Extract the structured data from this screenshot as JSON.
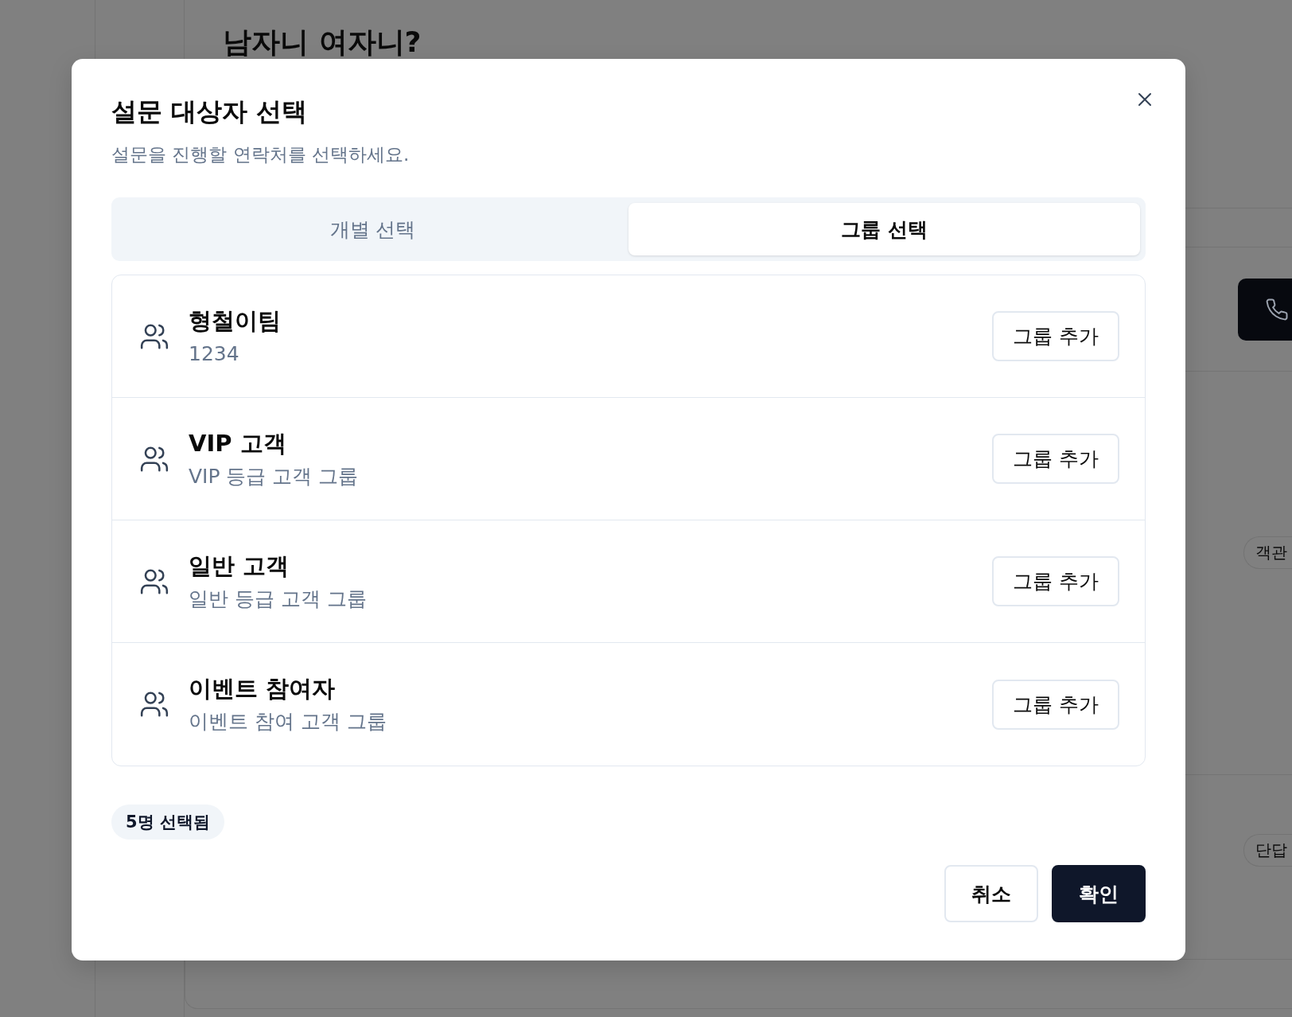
{
  "background": {
    "heading": "남자니 여자니?",
    "chips": [
      {
        "label": "객관"
      },
      {
        "label": "단답"
      }
    ]
  },
  "dialog": {
    "title": "설문 대상자 선택",
    "description": "설문을 진행할 연락처를 선택하세요.",
    "tabs": [
      {
        "label": "개별 선택",
        "selected": false
      },
      {
        "label": "그룹 선택",
        "selected": true
      }
    ],
    "groups": [
      {
        "name": "형철이팀",
        "description": "1234",
        "button": "그룹 추가"
      },
      {
        "name": "VIP 고객",
        "description": "VIP 등급 고객 그룹",
        "button": "그룹 추가"
      },
      {
        "name": "일반 고객",
        "description": "일반 등급 고객 그룹",
        "button": "그룹 추가"
      },
      {
        "name": "이벤트 참여자",
        "description": "이벤트 참여 고객 그룹",
        "button": "그룹 추가"
      }
    ],
    "selected_count": "5명 선택됨",
    "buttons": [
      {
        "kind": "cancel",
        "label": "취소"
      },
      {
        "kind": "confirm",
        "label": "확인"
      }
    ]
  }
}
